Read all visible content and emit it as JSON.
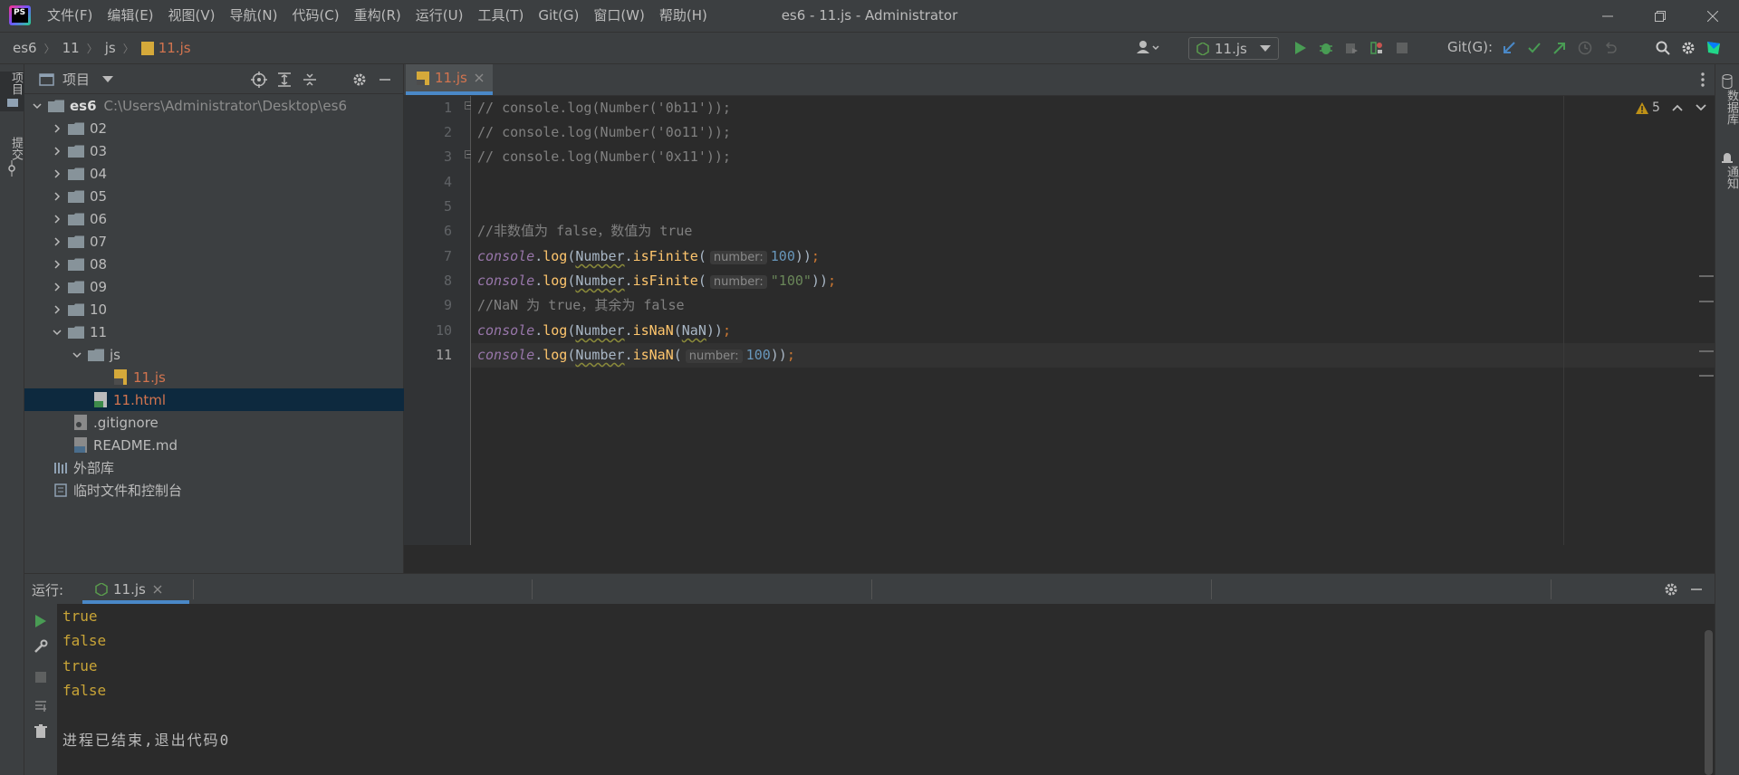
{
  "app": {
    "logo_text": "PS",
    "window_title": "es6 - 11.js - Administrator"
  },
  "menu": [
    "文件(F)",
    "编辑(E)",
    "视图(V)",
    "导航(N)",
    "代码(C)",
    "重构(R)",
    "运行(U)",
    "工具(T)",
    "Git(G)",
    "窗口(W)",
    "帮助(H)"
  ],
  "breadcrumb": [
    "es6",
    "11",
    "js",
    "11.js"
  ],
  "toolbar": {
    "run_config": "11.js",
    "git_label": "Git(G):"
  },
  "left_strip": {
    "project_tab": "项目",
    "commit_tab": "提交"
  },
  "right_strip": {
    "database_tab": "数据库",
    "notifications_tab": "通知"
  },
  "project": {
    "header": "项目",
    "root_name": "es6",
    "root_path": "C:\\Users\\Administrator\\Desktop\\es6",
    "folders": [
      "02",
      "03",
      "04",
      "05",
      "06",
      "07",
      "08",
      "09",
      "10"
    ],
    "open_folder": "11",
    "sub_folder": "js",
    "js_file": "11.js",
    "html_file": "11.html",
    "gitignore": ".gitignore",
    "readme": "README.md",
    "external_libs": "外部库",
    "scratches": "临时文件和控制台"
  },
  "editor": {
    "tab": "11.js",
    "warnings": "5",
    "line_numbers": [
      "1",
      "2",
      "3",
      "4",
      "5",
      "6",
      "7",
      "8",
      "9",
      "10",
      "11"
    ],
    "hint_label": "number:",
    "lines": {
      "l1": "// console.log(Number('0b11'));",
      "l2": "// console.log(Number('0o11'));",
      "l3": "// console.log(Number('0x11'));",
      "l6": "//非数值为 false，数值为 true",
      "l9": "//NaN 为 true，其余为 false",
      "console": "console",
      "dot": ".",
      "log": "log",
      "open": "(",
      "number": "Number",
      "isFinite": "isFinite",
      "isNaN": "isNaN",
      "val100": "100",
      "str100": "\"100\"",
      "nan": "NaN",
      "close": "))",
      "semi": ";"
    }
  },
  "run": {
    "label": "运行:",
    "tab": "11.js",
    "output": [
      "true",
      "false",
      "true",
      "false"
    ],
    "exit_message": "进程已结束,退出代码0"
  }
}
